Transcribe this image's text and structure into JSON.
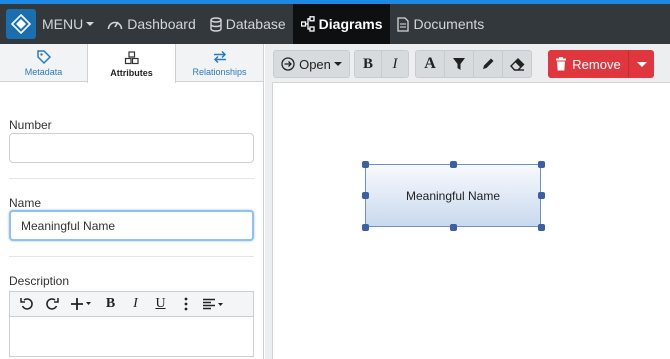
{
  "navbar": {
    "menu_label": "MENU",
    "items": [
      {
        "label": "Dashboard",
        "icon": "dashboard-icon"
      },
      {
        "label": "Database",
        "icon": "database-icon"
      },
      {
        "label": "Diagrams",
        "icon": "diagram-icon",
        "active": true
      },
      {
        "label": "Documents",
        "icon": "document-icon"
      }
    ],
    "accent": "#1e88e5"
  },
  "left_panel": {
    "tabs": [
      {
        "label": "Metadata",
        "icon": "tag-icon"
      },
      {
        "label": "Attributes",
        "icon": "cubes-icon",
        "active": true
      },
      {
        "label": "Relationships",
        "icon": "exchange-icon"
      }
    ],
    "fields": {
      "number": {
        "label": "Number",
        "value": ""
      },
      "name": {
        "label": "Name",
        "value": "Meaningful Name"
      },
      "description": {
        "label": "Description",
        "value": ""
      }
    }
  },
  "toolbar": {
    "open_label": "Open",
    "remove_label": "Remove",
    "remove_color": "#e0373f"
  },
  "canvas": {
    "node_label": "Meaningful Name"
  }
}
